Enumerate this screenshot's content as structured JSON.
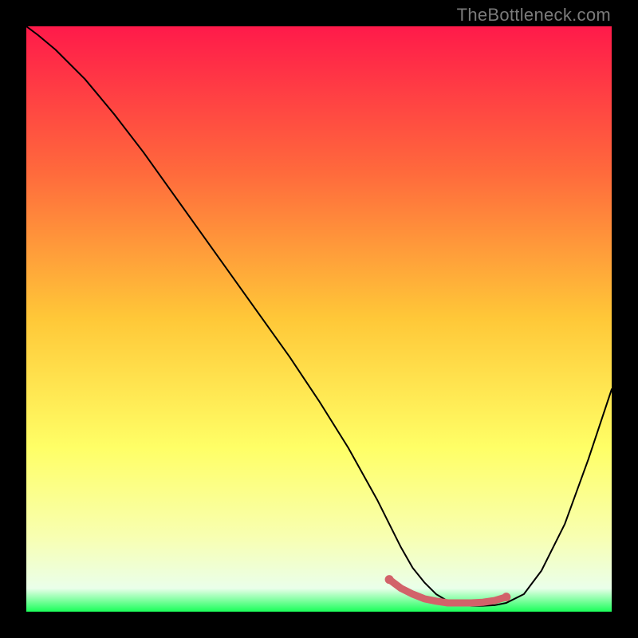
{
  "watermark": "TheBottleneck.com",
  "chart_data": {
    "type": "line",
    "title": "",
    "xlabel": "",
    "ylabel": "",
    "xlim": [
      0,
      100
    ],
    "ylim": [
      0,
      100
    ],
    "background_gradient": {
      "stops": [
        {
          "offset": 0,
          "color": "#ff1a4a"
        },
        {
          "offset": 25,
          "color": "#ff6a3c"
        },
        {
          "offset": 50,
          "color": "#ffc838"
        },
        {
          "offset": 72,
          "color": "#ffff66"
        },
        {
          "offset": 87,
          "color": "#f8ffb0"
        },
        {
          "offset": 96,
          "color": "#eaffea"
        },
        {
          "offset": 100,
          "color": "#1aff5a"
        }
      ]
    },
    "series": [
      {
        "name": "bottleneck-curve",
        "color": "#000000",
        "x": [
          0,
          2,
          5,
          10,
          15,
          20,
          25,
          30,
          35,
          40,
          45,
          50,
          55,
          60,
          62,
          64,
          66,
          68,
          70,
          72,
          74,
          76,
          78,
          80,
          82,
          85,
          88,
          92,
          96,
          100
        ],
        "y": [
          100,
          98.5,
          96,
          91,
          85,
          78.5,
          71.5,
          64.5,
          57.5,
          50.5,
          43.5,
          36,
          28,
          19,
          15,
          11,
          7.5,
          5,
          3,
          1.8,
          1.2,
          1.0,
          1.0,
          1.1,
          1.5,
          3,
          7,
          15,
          26,
          38
        ]
      },
      {
        "name": "optimal-range-marker",
        "color": "#d2626a",
        "thick": true,
        "x": [
          62,
          64,
          66,
          68,
          70,
          72,
          74,
          76,
          78,
          80,
          82
        ],
        "y": [
          5.5,
          4.0,
          3.0,
          2.2,
          1.8,
          1.5,
          1.5,
          1.5,
          1.6,
          1.9,
          2.5
        ]
      }
    ]
  }
}
